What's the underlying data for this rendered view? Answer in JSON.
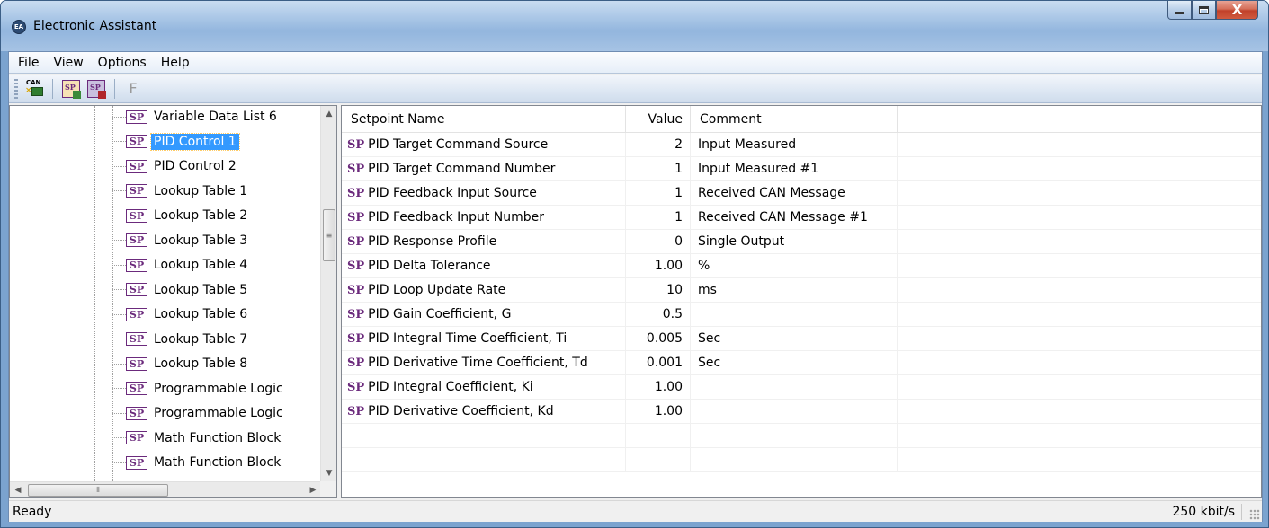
{
  "window": {
    "title": "Electronic Assistant",
    "icon_text": "EA",
    "close_glyph": "X"
  },
  "menu": [
    "File",
    "View",
    "Options",
    "Help"
  ],
  "toolbar": {
    "can_label": "CAN",
    "sp_label": "SP",
    "f_label": "F"
  },
  "tree": {
    "badge": "SP",
    "selected_index": 1,
    "items": [
      "Variable Data List 6",
      "PID Control 1",
      "PID Control 2",
      "Lookup Table 1",
      "Lookup Table 2",
      "Lookup Table 3",
      "Lookup Table 4",
      "Lookup Table 5",
      "Lookup Table 6",
      "Lookup Table 7",
      "Lookup Table 8",
      "Programmable Logic",
      "Programmable Logic",
      "Math Function Block",
      "Math Function Block"
    ]
  },
  "list": {
    "headers": {
      "name": "Setpoint Name",
      "value": "Value",
      "comment": "Comment"
    },
    "prefix": "SP",
    "rows": [
      {
        "name": "PID Target Command Source",
        "value": "2",
        "comment": "Input Measured"
      },
      {
        "name": "PID Target Command Number",
        "value": "1",
        "comment": "Input Measured #1"
      },
      {
        "name": "PID Feedback Input Source",
        "value": "1",
        "comment": "Received CAN Message"
      },
      {
        "name": "PID Feedback Input Number",
        "value": "1",
        "comment": "Received CAN Message #1"
      },
      {
        "name": "PID Response Profile",
        "value": "0",
        "comment": "Single Output"
      },
      {
        "name": "PID Delta Tolerance",
        "value": "1.00",
        "comment": "%"
      },
      {
        "name": "PID Loop Update Rate",
        "value": "10",
        "comment": "ms"
      },
      {
        "name": "PID Gain Coefficient, G",
        "value": "0.5",
        "comment": ""
      },
      {
        "name": "PID Integral Time Coefficient, Ti",
        "value": "0.005",
        "comment": "Sec"
      },
      {
        "name": "PID Derivative Time Coefficient, Td",
        "value": "0.001",
        "comment": "Sec"
      },
      {
        "name": "PID Integral Coefficient, Ki",
        "value": "1.00",
        "comment": ""
      },
      {
        "name": "PID Derivative Coefficient, Kd",
        "value": "1.00",
        "comment": ""
      }
    ],
    "empty_rows": 2
  },
  "status": {
    "left": "Ready",
    "right": "250 kbit/s"
  },
  "colors": {
    "sp_purple": "#6b2a7c",
    "selection": "#3399ff",
    "title_bar": "#a9c6e6"
  }
}
